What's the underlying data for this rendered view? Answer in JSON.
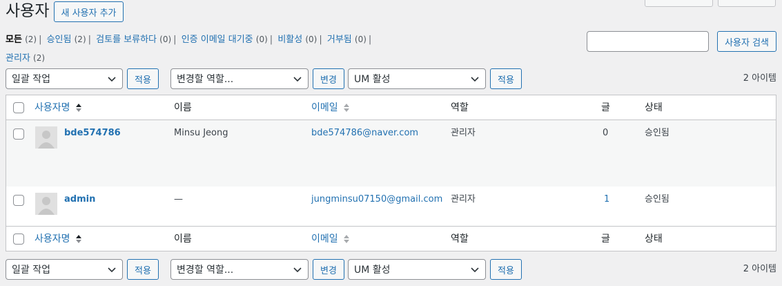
{
  "page": {
    "title": "사용자",
    "add_new_label": "새 사용자 추가"
  },
  "views": [
    {
      "label": "모든",
      "count": "(2)",
      "current": true
    },
    {
      "label": "승인됨",
      "count": "(2)"
    },
    {
      "label": "검토를 보류하다",
      "count": "(0)"
    },
    {
      "label": "인증 이메일 대기중",
      "count": "(0)"
    },
    {
      "label": "비활성",
      "count": "(0)"
    },
    {
      "label": "거부됨",
      "count": "(0)"
    },
    {
      "label": "관리자",
      "count": "(2)"
    }
  ],
  "search": {
    "value": "",
    "button_label": "사용자 검색"
  },
  "tablenav": {
    "bulk_action": "일괄 작업",
    "apply_label": "적용",
    "change_role": "변경할 역할...",
    "change_label": "변경",
    "um_action": "UM 활성",
    "um_apply_label": "적용",
    "items_count": "2 아이템"
  },
  "columns": {
    "username": "사용자명",
    "name": "이름",
    "email": "이메일",
    "role": "역할",
    "posts": "글",
    "status": "상태"
  },
  "users": [
    {
      "username": "bde574786",
      "name": "Minsu Jeong",
      "email": "bde574786@naver.com",
      "role": "관리자",
      "posts": "0",
      "status": "승인됨"
    },
    {
      "username": "admin",
      "name": "—",
      "email": "jungminsu07150@gmail.com",
      "role": "관리자",
      "posts": "1",
      "status": "승인됨"
    }
  ],
  "icons": {
    "sort": "sort-arrows-icon",
    "dropdown": "chevron-down-icon",
    "avatar": "default-avatar-icon"
  },
  "colors": {
    "link": "#2271b1",
    "background": "#f0f0f1",
    "border": "#c3c4c7"
  }
}
